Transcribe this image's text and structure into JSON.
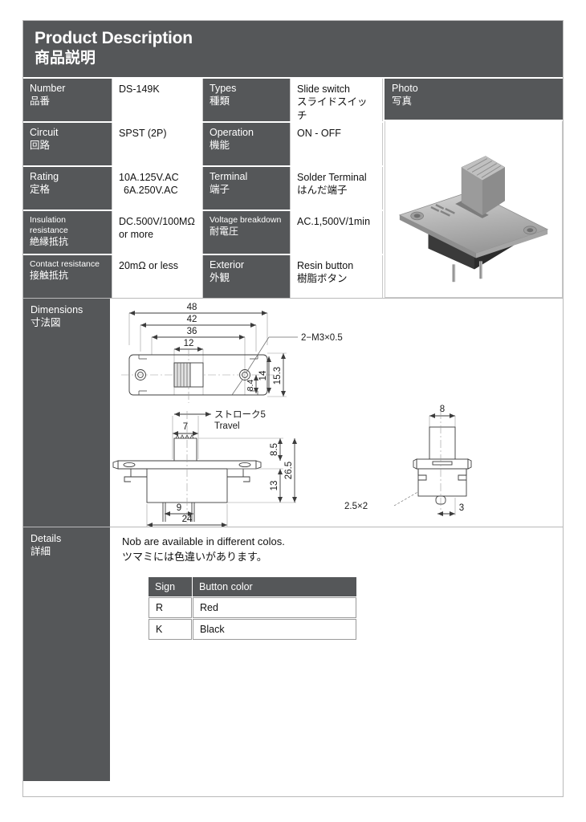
{
  "header": {
    "title_en": "Product Description",
    "title_ja": "商品説明"
  },
  "spec": {
    "rows": [
      {
        "label_en": "Number",
        "label_ja": "品番",
        "value_line1": "DS-149K",
        "value_line2": "",
        "label2_en": "Types",
        "label2_ja": "種類",
        "value2_line1": "Slide switch",
        "value2_line2": "スライドスイッチ"
      },
      {
        "label_en": "Circuit",
        "label_ja": "回路",
        "value_line1": "SPST (2P)",
        "value_line2": "",
        "label2_en": "Operation",
        "label2_ja": "機能",
        "value2_line1": "ON - OFF",
        "value2_line2": ""
      },
      {
        "label_en": "Rating",
        "label_ja": "定格",
        "value_line1": "10A.125V.AC",
        "value_line2": "6A.250V.AC",
        "label2_en": "Terminal",
        "label2_ja": "端子",
        "value2_line1": "Solder Terminal",
        "value2_line2": "はんだ端子"
      },
      {
        "label_en": "Insulation resistance",
        "label_ja": "絶縁抵抗",
        "value_line1": "DC.500V/100MΩ",
        "value_line2": "or more",
        "label2_en": "Voltage breakdown",
        "label2_ja": "耐電圧",
        "value2_line1": "AC.1,500V/1min",
        "value2_line2": ""
      },
      {
        "label_en": "Contact resistance",
        "label_ja": "接触抵抗",
        "value_line1": "20mΩ or less",
        "value_line2": "",
        "label2_en": "Exterior",
        "label2_ja": "外観",
        "value2_line1": "Resin button",
        "value2_line2": "樹脂ボタン"
      }
    ],
    "photo": {
      "label_en": "Photo",
      "label_ja": "写真"
    }
  },
  "dimensions": {
    "label_en": "Dimensions",
    "label_ja": "寸法図",
    "top_view": {
      "width_overall": "48",
      "width_mount": "42",
      "width_inner": "36",
      "width_knob": "12",
      "height_hole": "8.4",
      "height_inner": "14",
      "height_overall": "15.3",
      "thread_callout": "2−M3×0.5"
    },
    "side_view": {
      "travel_ja": "ストローク5",
      "travel_en": "Travel",
      "knob_width": "7",
      "pin_pitch": "9",
      "body_width": "24",
      "knob_height": "8.5",
      "body_height": "13",
      "total_height": "26.5",
      "terminal_note": "2.5×2"
    },
    "end_view": {
      "width": "8",
      "pin_offset": "3"
    }
  },
  "details": {
    "label_en": "Details",
    "label_ja": "詳細",
    "note_en": "Nob are available in different colos.",
    "note_ja": "ツマミには色違いがあります。",
    "table": {
      "headers": [
        "Sign",
        "Button color"
      ],
      "rows": [
        {
          "sign": "R",
          "color": "Red"
        },
        {
          "sign": "K",
          "color": "Black"
        }
      ]
    }
  },
  "colors": {
    "label_bg": "#555759",
    "page_border": "#b9b9b9",
    "cell_border": "#c9c9c9",
    "text": "#1a1a1a"
  }
}
